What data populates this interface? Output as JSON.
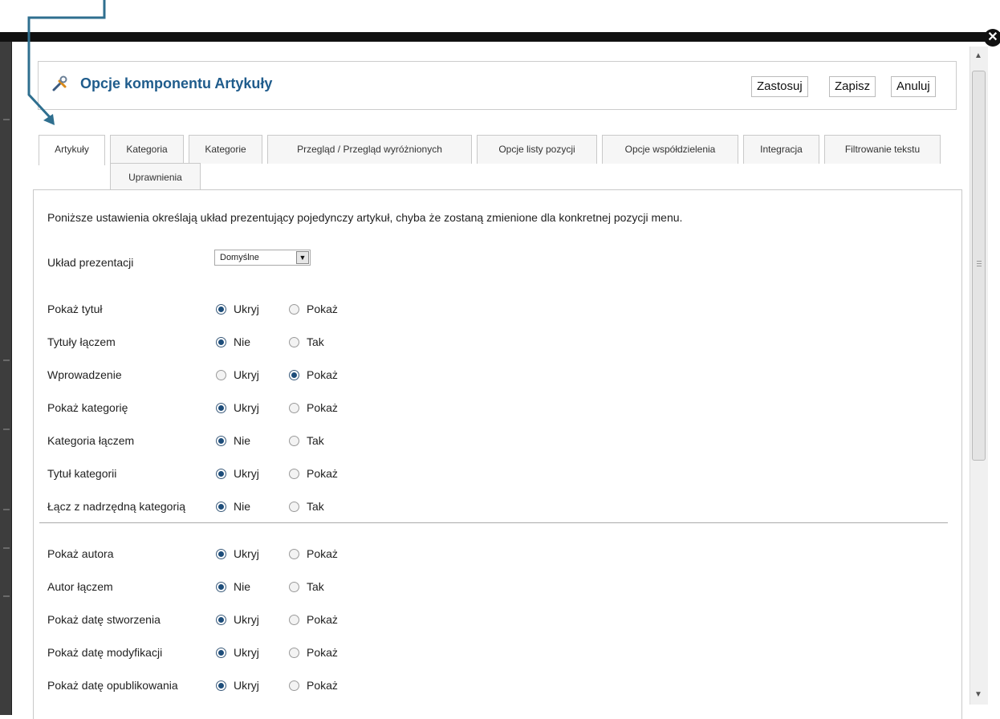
{
  "header": {
    "title": "Opcje komponentu Artykuły",
    "buttons": [
      "Zastosuj",
      "Zapisz",
      "Anuluj"
    ]
  },
  "tabs_row1": [
    "Artykuły",
    "Kategoria",
    "Kategorie",
    "Przegląd / Przegląd wyróżnionych",
    "Opcje listy pozycji",
    "Opcje współdzielenia",
    "Integracja",
    "Filtrowanie tekstu"
  ],
  "tabs_row2": [
    "Uprawnienia"
  ],
  "active_tab": "Artykuły",
  "description": "Poniższe ustawienia określają układ prezentujący pojedynczy artykuł, chyba że zostaną zmienione dla konkretnej pozycji menu.",
  "layout_field": {
    "label": "Układ prezentacji",
    "value": "Domyślne"
  },
  "options": [
    {
      "label": "Pokaż tytuł",
      "choices": [
        "Ukryj",
        "Pokaż"
      ],
      "selected": 0
    },
    {
      "label": "Tytuły łączem",
      "choices": [
        "Nie",
        "Tak"
      ],
      "selected": 0
    },
    {
      "label": "Wprowadzenie",
      "choices": [
        "Ukryj",
        "Pokaż"
      ],
      "selected": 1
    },
    {
      "label": "Pokaż kategorię",
      "choices": [
        "Ukryj",
        "Pokaż"
      ],
      "selected": 0
    },
    {
      "label": "Kategoria łączem",
      "choices": [
        "Nie",
        "Tak"
      ],
      "selected": 0
    },
    {
      "label": "Tytuł kategorii",
      "choices": [
        "Ukryj",
        "Pokaż"
      ],
      "selected": 0
    },
    {
      "label": "Łącz z nadrzędną kategorią",
      "choices": [
        "Nie",
        "Tak"
      ],
      "selected": 0
    },
    {
      "label": "Pokaż autora",
      "choices": [
        "Ukryj",
        "Pokaż"
      ],
      "selected": 0
    },
    {
      "label": "Autor łączem",
      "choices": [
        "Nie",
        "Tak"
      ],
      "selected": 0
    },
    {
      "label": "Pokaż datę stworzenia",
      "choices": [
        "Ukryj",
        "Pokaż"
      ],
      "selected": 0
    },
    {
      "label": "Pokaż datę modyfikacji",
      "choices": [
        "Ukryj",
        "Pokaż"
      ],
      "selected": 0
    },
    {
      "label": "Pokaż datę opublikowania",
      "choices": [
        "Ukryj",
        "Pokaż"
      ],
      "selected": 0
    }
  ],
  "colors": {
    "title": "#1f5c8c",
    "annotation_arrow": "#2f6f8f"
  }
}
